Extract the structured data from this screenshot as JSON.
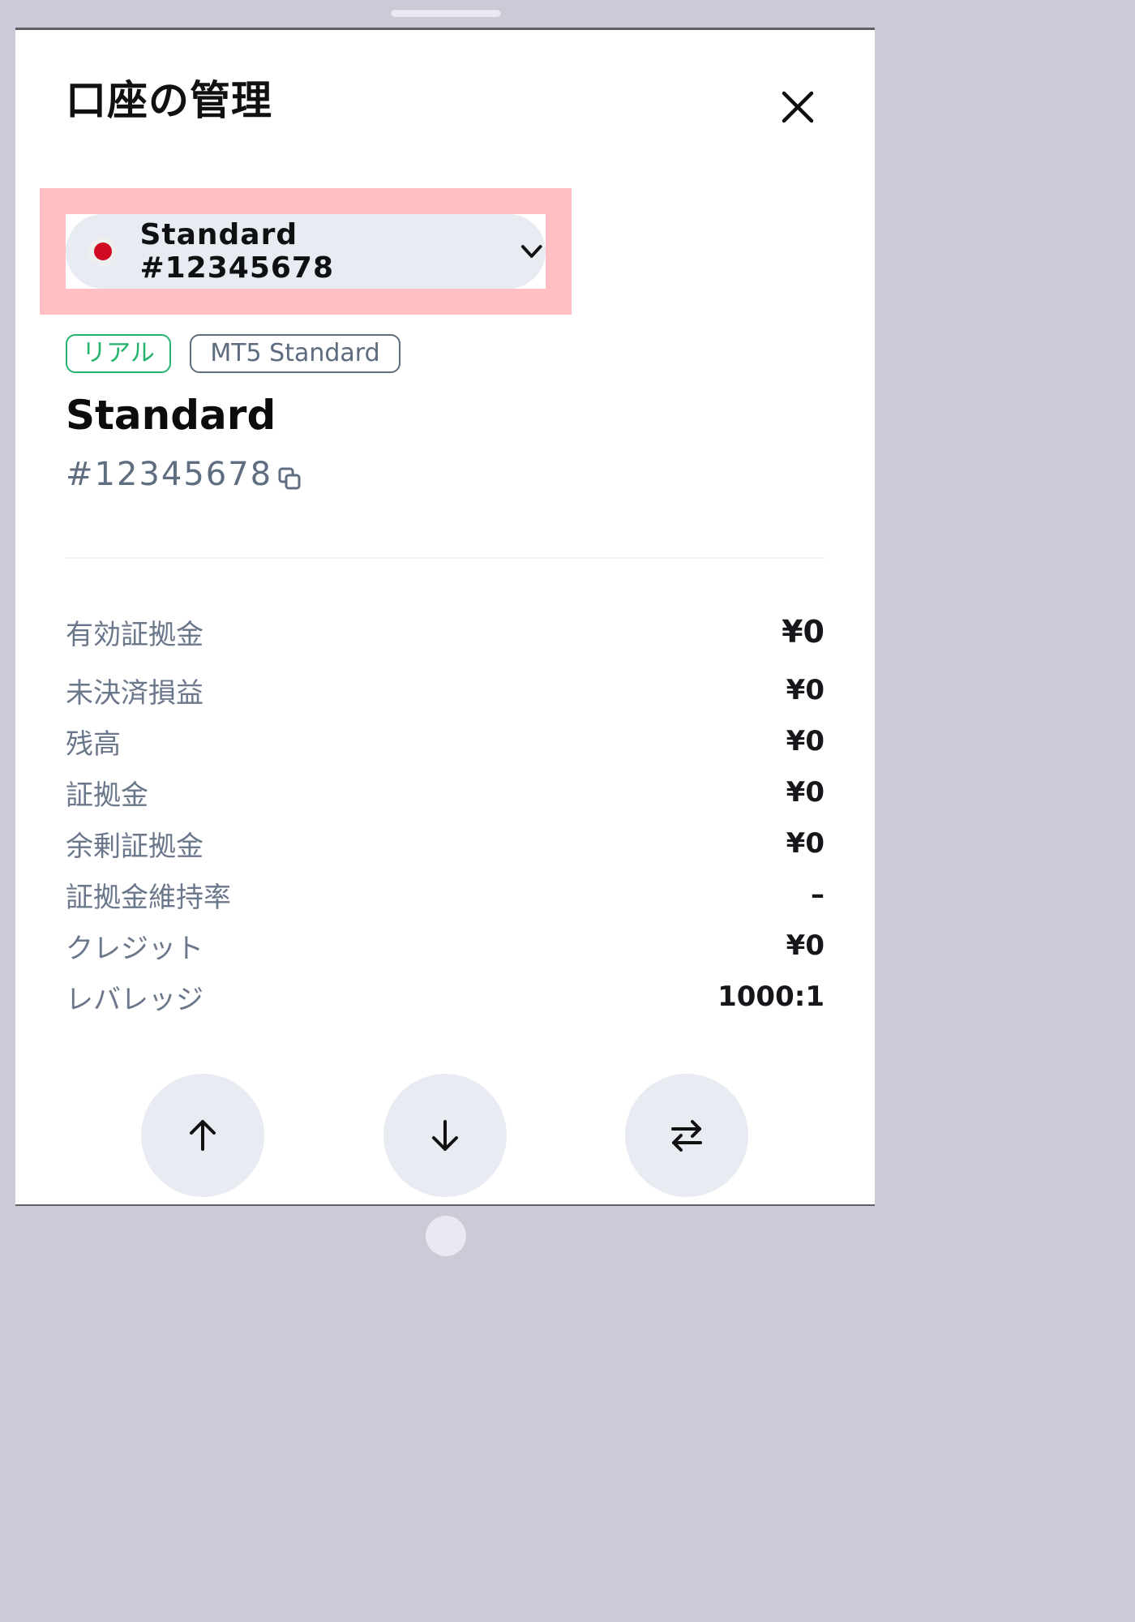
{
  "page": {
    "title": "口座の管理",
    "close_icon": "close-icon"
  },
  "selector": {
    "label": "Standard #12345678",
    "flag_color": "#d10a21",
    "icon": "chevron-down-icon"
  },
  "tags": [
    {
      "label": "リアル",
      "color": "#23b36b"
    },
    {
      "label": "MT5 Standard",
      "color": "#5d6b7e"
    }
  ],
  "account": {
    "name": "Standard",
    "number": "#12345678",
    "copy_icon": "copy-icon"
  },
  "stats": [
    {
      "label": "有効証拠金",
      "value": "¥0"
    },
    {
      "label": "未決済損益",
      "value": "¥0"
    },
    {
      "label": "残高",
      "value": "¥0"
    },
    {
      "label": "証拠金",
      "value": "¥0"
    },
    {
      "label": "余剰証拠金",
      "value": "¥0"
    },
    {
      "label": "証拠金維持率",
      "value": "–"
    },
    {
      "label": "クレジット",
      "value": "¥0"
    },
    {
      "label": "レバレッジ",
      "value": "1000:1"
    }
  ],
  "actions": [
    {
      "icon": "arrow-up-icon"
    },
    {
      "icon": "arrow-down-icon"
    },
    {
      "icon": "swap-icon"
    }
  ],
  "colors": {
    "highlight": "#ffbfc3",
    "accent_green": "#23b36b",
    "button_bg": "#e8ebf2"
  }
}
